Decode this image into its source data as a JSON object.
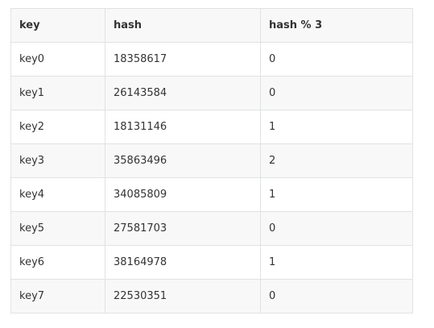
{
  "table": {
    "headers": [
      "key",
      "hash",
      "hash % 3"
    ],
    "rows": [
      [
        "key0",
        "18358617",
        "0"
      ],
      [
        "key1",
        "26143584",
        "0"
      ],
      [
        "key2",
        "18131146",
        "1"
      ],
      [
        "key3",
        "35863496",
        "2"
      ],
      [
        "key4",
        "34085809",
        "1"
      ],
      [
        "key5",
        "27581703",
        "0"
      ],
      [
        "key6",
        "38164978",
        "1"
      ],
      [
        "key7",
        "22530351",
        "0"
      ]
    ]
  },
  "colors": {
    "border": "#dfe2e5",
    "header_bg": "#f8f8f8",
    "stripe_bg": "#f8f8f8",
    "text": "#333333"
  }
}
